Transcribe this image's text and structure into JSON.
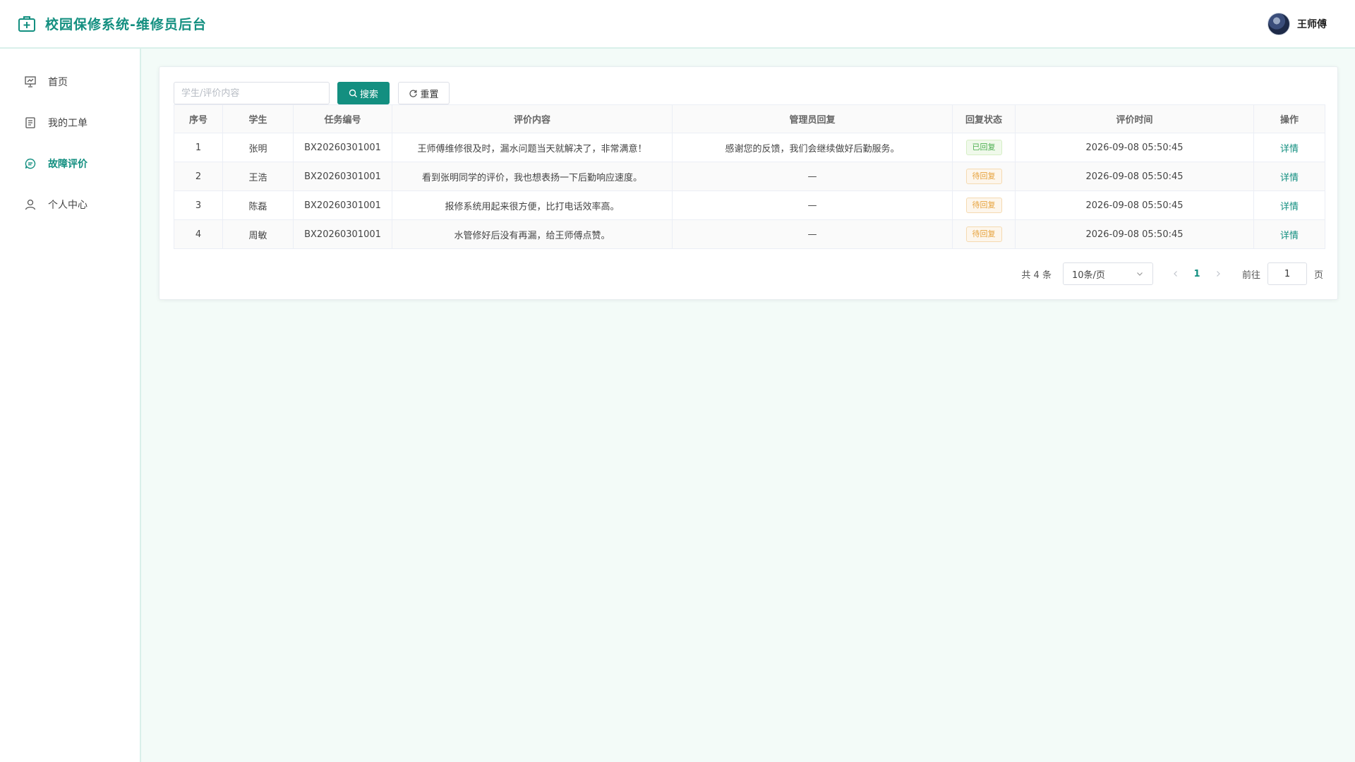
{
  "header": {
    "title": "校园保修系统-维修员后台",
    "user_name": "王师傅"
  },
  "sidebar": {
    "items": [
      {
        "label": "首页",
        "icon": "presentation-icon"
      },
      {
        "label": "我的工单",
        "icon": "document-icon"
      },
      {
        "label": "故障评价",
        "icon": "chat-bubble-icon",
        "active": true
      },
      {
        "label": "个人中心",
        "icon": "user-icon"
      }
    ]
  },
  "toolbar": {
    "search_placeholder": "学生/评价内容",
    "search_label": "搜索",
    "reset_label": "重置"
  },
  "table": {
    "columns": [
      "序号",
      "学生",
      "任务编号",
      "评价内容",
      "管理员回复",
      "回复状态",
      "评价时间",
      "操作"
    ],
    "rows": [
      {
        "index": "1",
        "student": "张明",
        "task_no": "BX20260301001",
        "content": "王师傅维修很及时，漏水问题当天就解决了，非常满意！",
        "reply": "感谢您的反馈，我们会继续做好后勤服务。",
        "status": "已回复",
        "time": "2026-09-08 05:50:45",
        "action": "详情"
      },
      {
        "index": "2",
        "student": "王浩",
        "task_no": "BX20260301001",
        "content": "看到张明同学的评价，我也想表扬一下后勤响应速度。",
        "reply": "—",
        "status": "待回复",
        "time": "2026-09-08 05:50:45",
        "action": "详情"
      },
      {
        "index": "3",
        "student": "陈磊",
        "task_no": "BX20260301001",
        "content": "报修系统用起来很方便，比打电话效率高。",
        "reply": "—",
        "status": "待回复",
        "time": "2026-09-08 05:50:45",
        "action": "详情"
      },
      {
        "index": "4",
        "student": "周敏",
        "task_no": "BX20260301001",
        "content": "水管修好后没有再漏，给王师傅点赞。",
        "reply": "—",
        "status": "待回复",
        "time": "2026-09-08 05:50:45",
        "action": "详情"
      }
    ]
  },
  "pagination": {
    "total_text": "共 4 条",
    "page_size": "10条/页",
    "current_page": "1",
    "goto_label": "前往",
    "goto_value": "1",
    "page_suffix": "页"
  },
  "colors": {
    "brand": "#138f80",
    "replied": "#4caf50",
    "pending": "#e6a23c"
  }
}
